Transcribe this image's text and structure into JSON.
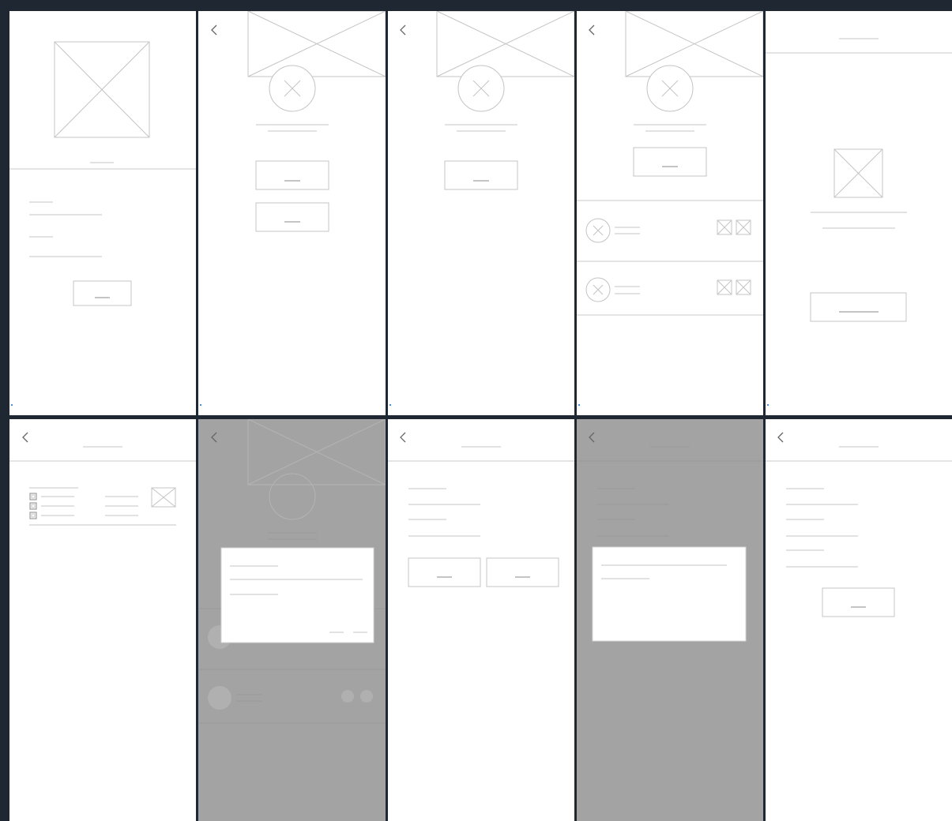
{
  "canvas": {
    "name": "wireframe-board",
    "background_color": "#1f2733",
    "frame_color": "#ffffff",
    "overlay_color": "#a3a3a3",
    "frames": [
      {
        "id": "welcome",
        "overlay": false,
        "has_back": false
      },
      {
        "id": "item-detail-two-actions",
        "overlay": false,
        "has_back": true
      },
      {
        "id": "item-detail-one-action",
        "overlay": false,
        "has_back": true
      },
      {
        "id": "item-detail-with-list",
        "overlay": false,
        "has_back": true
      },
      {
        "id": "confirmation",
        "overlay": false,
        "has_back": false
      },
      {
        "id": "checklist",
        "overlay": false,
        "has_back": true
      },
      {
        "id": "item-detail-dialog",
        "overlay": true,
        "has_back": true
      },
      {
        "id": "form-two-buttons",
        "overlay": false,
        "has_back": true
      },
      {
        "id": "form-dialog",
        "overlay": true,
        "has_back": true
      },
      {
        "id": "form-submit",
        "overlay": false,
        "has_back": true
      }
    ],
    "icons": [
      "image-placeholder-icon",
      "avatar-placeholder-icon",
      "back-chevron-icon",
      "checkbox-icon"
    ]
  }
}
